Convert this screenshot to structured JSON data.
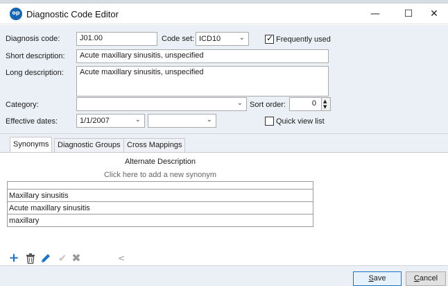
{
  "window": {
    "title": "Diagnostic Code Editor",
    "app_icon_text": "op",
    "min_glyph": "—",
    "max_glyph": "☐",
    "close_glyph": "✕"
  },
  "form": {
    "diagnosis_code_label": "Diagnosis code:",
    "diagnosis_code_value": "J01.00",
    "code_set_label": "Code set:",
    "code_set_value": "ICD10",
    "frequently_used_label": "Frequently used",
    "frequently_used_checked": true,
    "short_description_label": "Short description:",
    "short_description_value": "Acute maxillary sinusitis, unspecified",
    "long_description_label": "Long description:",
    "long_description_value": "Acute maxillary sinusitis, unspecified",
    "category_label": "Category:",
    "category_value": "",
    "sort_order_label": "Sort order:",
    "sort_order_value": "0",
    "effective_dates_label": "Effective dates:",
    "effective_start_value": "1/1/2007",
    "effective_end_value": "",
    "quick_view_label": "Quick view list",
    "quick_view_checked": false
  },
  "tabs": [
    {
      "label": "Synonyms",
      "active": true
    },
    {
      "label": "Diagnostic Groups",
      "active": false
    },
    {
      "label": "Cross Mappings",
      "active": false
    }
  ],
  "synonyms": {
    "column_header": "Alternate Description",
    "add_hint": "Click here to add a new synonym",
    "rows": [
      "Maxillary sinusitis",
      "Acute maxillary sinusitis",
      "maxillary"
    ]
  },
  "toolbar": {
    "icons": [
      "add-icon",
      "delete-icon",
      "edit-icon",
      "confirm-icon",
      "cancel-icon"
    ],
    "scroll_left_glyph": "<"
  },
  "buttons": {
    "save_first": "S",
    "save_rest": "ave",
    "cancel_first": "C",
    "cancel_rest": "ancel"
  }
}
